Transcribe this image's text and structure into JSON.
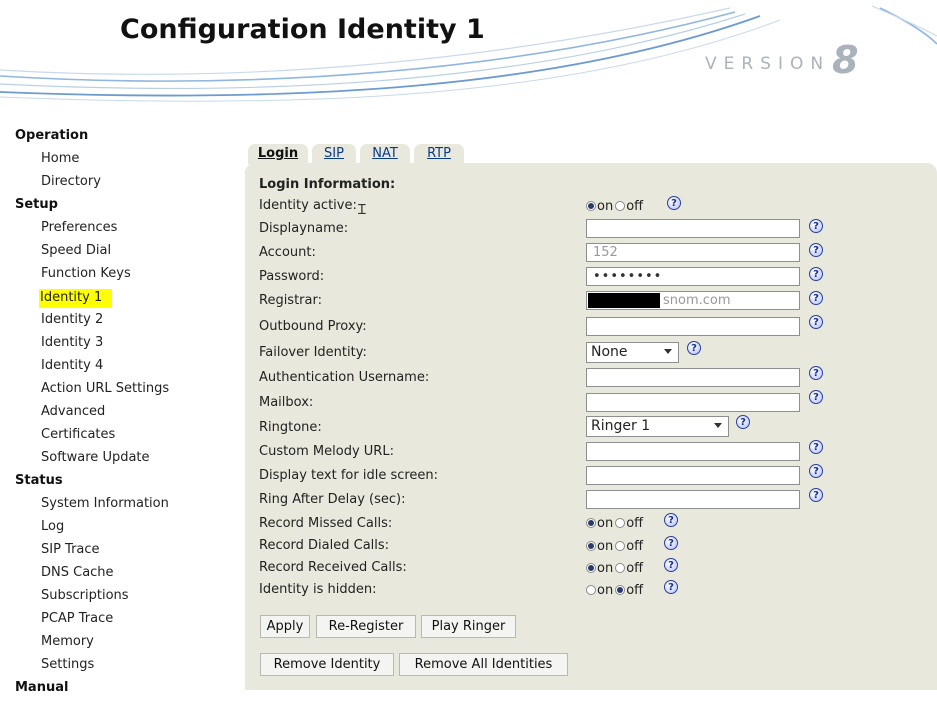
{
  "header": {
    "title": "Configuration Identity 1",
    "version_word": "VERSION",
    "version_number": "8"
  },
  "sidebar": {
    "sections": [
      {
        "title": "Operation",
        "items": [
          {
            "label": "Home"
          },
          {
            "label": "Directory"
          }
        ]
      },
      {
        "title": "Setup",
        "items": [
          {
            "label": "Preferences"
          },
          {
            "label": "Speed Dial"
          },
          {
            "label": "Function Keys"
          },
          {
            "label": "Identity 1",
            "active": true
          },
          {
            "label": "Identity 2"
          },
          {
            "label": "Identity 3"
          },
          {
            "label": "Identity 4"
          },
          {
            "label": "Action URL Settings"
          },
          {
            "label": "Advanced"
          },
          {
            "label": "Certificates"
          },
          {
            "label": "Software Update"
          }
        ]
      },
      {
        "title": "Status",
        "items": [
          {
            "label": "System Information"
          },
          {
            "label": "Log"
          },
          {
            "label": "SIP Trace"
          },
          {
            "label": "DNS Cache"
          },
          {
            "label": "Subscriptions"
          },
          {
            "label": "PCAP Trace"
          },
          {
            "label": "Memory"
          },
          {
            "label": "Settings"
          }
        ]
      },
      {
        "title": "Manual",
        "items": []
      }
    ]
  },
  "tabs": [
    {
      "label": "Login",
      "active": true
    },
    {
      "label": "SIP"
    },
    {
      "label": "NAT"
    },
    {
      "label": "RTP"
    }
  ],
  "form": {
    "section_title": "Login Information:",
    "help_glyph": "?",
    "radio_on": "on",
    "radio_off": "off",
    "fields": {
      "identity_active": {
        "label": "Identity active:",
        "value": "on"
      },
      "displayname": {
        "label": "Displayname:",
        "value": ""
      },
      "account": {
        "label": "Account:",
        "value": "152"
      },
      "password": {
        "label": "Password:",
        "value": "••••••••"
      },
      "registrar": {
        "label": "Registrar:",
        "value": "snom.com"
      },
      "outbound_proxy": {
        "label": "Outbound Proxy:",
        "value": ""
      },
      "failover_identity": {
        "label": "Failover Identity:",
        "value": "None"
      },
      "auth_username": {
        "label": "Authentication Username:",
        "value": ""
      },
      "mailbox": {
        "label": "Mailbox:",
        "value": ""
      },
      "ringtone": {
        "label": "Ringtone:",
        "value": "Ringer 1"
      },
      "custom_melody_url": {
        "label": "Custom Melody URL:",
        "value": ""
      },
      "idle_text": {
        "label": "Display text for idle screen:",
        "value": ""
      },
      "ring_after_delay": {
        "label": "Ring After Delay (sec):",
        "value": ""
      },
      "record_missed": {
        "label": "Record Missed Calls:",
        "value": "on"
      },
      "record_dialed": {
        "label": "Record Dialed Calls:",
        "value": "on"
      },
      "record_received": {
        "label": "Record Received Calls:",
        "value": "on"
      },
      "identity_hidden": {
        "label": "Identity is hidden:",
        "value": "off"
      }
    }
  },
  "buttons": {
    "apply": "Apply",
    "reregister": "Re-Register",
    "play_ringer": "Play Ringer",
    "remove_identity": "Remove Identity",
    "remove_all": "Remove All Identities"
  },
  "colors": {
    "panel_bg": "#e9e8dc",
    "active_highlight": "#ffff00",
    "header_swoosh": "#8fb6e0"
  }
}
